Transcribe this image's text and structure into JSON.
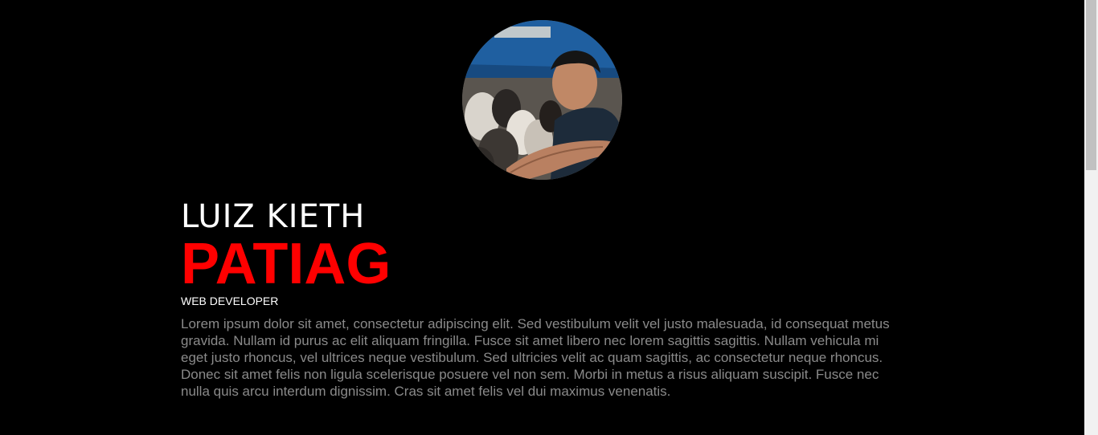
{
  "profile": {
    "first_name": "LUIZ KIETH",
    "last_name": "PATIAG",
    "role": "WEB DEVELOPER",
    "bio": "Lorem ipsum dolor sit amet, consectetur adipiscing elit. Sed vestibulum velit vel justo malesuada, id consequat metus gravida. Nullam id purus ac elit aliquam fringilla. Fusce sit amet libero nec lorem sagittis sagittis. Nullam vehicula mi eget justo rhoncus, vel ultrices neque vestibulum. Sed ultricies velit ac quam sagittis, ac consectetur neque rhoncus. Donec sit amet felis non ligula scelerisque posuere vel non sem. Morbi in metus a risus aliquam suscipit. Fusce nec nulla quis arcu interdum dignissim. Cras sit amet felis vel dui maximus venenatis."
  },
  "colors": {
    "background": "#000000",
    "accent": "#ff0000",
    "text": "#ffffff",
    "muted": "#8a8a8a"
  }
}
